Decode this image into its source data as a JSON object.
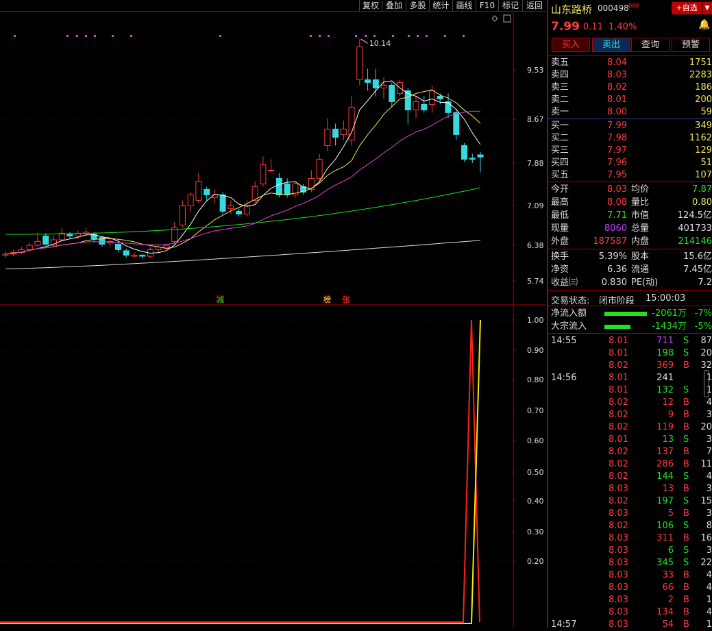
{
  "toolbar": {
    "items": [
      "复权",
      "叠加",
      "多股",
      "统计",
      "画线",
      "F10",
      "标记",
      "返回"
    ]
  },
  "stock": {
    "name": "山东路桥",
    "code": "000498",
    "superscript": "000",
    "price": "7.99",
    "change": "0.11",
    "pct": "1.40%",
    "self_select": "+自选"
  },
  "actions": [
    "买入",
    "卖出",
    "查询",
    "预警"
  ],
  "sells": [
    {
      "label": "卖五",
      "price": "8.04",
      "vol": "1751"
    },
    {
      "label": "卖四",
      "price": "8.03",
      "vol": "2283"
    },
    {
      "label": "卖三",
      "price": "8.02",
      "vol": "186"
    },
    {
      "label": "卖二",
      "price": "8.01",
      "vol": "200"
    },
    {
      "label": "卖一",
      "price": "8.00",
      "vol": "59"
    }
  ],
  "buys": [
    {
      "label": "买一",
      "price": "7.99",
      "vol": "349"
    },
    {
      "label": "买二",
      "price": "7.98",
      "vol": "1162"
    },
    {
      "label": "买三",
      "price": "7.97",
      "vol": "129"
    },
    {
      "label": "买四",
      "price": "7.96",
      "vol": "51"
    },
    {
      "label": "买五",
      "price": "7.95",
      "vol": "107"
    }
  ],
  "stats1": [
    {
      "l": "今开",
      "v": "8.03",
      "l2": "均价",
      "v2": "7.87"
    },
    {
      "l": "最高",
      "v": "8.08",
      "l2": "量比",
      "v2": "0.80"
    },
    {
      "l": "最低",
      "v": "7.71",
      "l2": "市值",
      "v2": "124.5亿"
    },
    {
      "l": "现量",
      "v": "8060",
      "l2": "总量",
      "v2": "401733"
    },
    {
      "l": "外盘",
      "v": "187587",
      "l2": "内盘",
      "v2": "214146"
    }
  ],
  "stats2": [
    {
      "l": "换手",
      "v": "5.39%",
      "l2": "股本",
      "v2": "15.6亿"
    },
    {
      "l": "净资",
      "v": "6.36",
      "l2": "流通",
      "v2": "7.45亿"
    },
    {
      "l": "收益㈢",
      "v": "0.830",
      "l2": "PE(动)",
      "v2": "7.2"
    }
  ],
  "status": {
    "label": "交易状态:",
    "value": "闭市阶段",
    "time": "15:00:03"
  },
  "flows": [
    {
      "label": "净流入额",
      "amount": "-2061万",
      "pct": "-7%"
    },
    {
      "label": "大宗流入",
      "amount": "-1434万",
      "pct": "-5%"
    }
  ],
  "ticks": [
    {
      "t": "14:55",
      "p": "8.01",
      "v": "711",
      "d": "S",
      "n": "87"
    },
    {
      "t": "",
      "p": "8.01",
      "v": "198",
      "d": "S",
      "n": "20"
    },
    {
      "t": "",
      "p": "8.02",
      "v": "369",
      "d": "B",
      "n": "32"
    },
    {
      "t": "14:56",
      "p": "8.01",
      "v": "241",
      "d": "",
      "n": "1"
    },
    {
      "t": "",
      "p": "8.01",
      "v": "132",
      "d": "S",
      "n": "1"
    },
    {
      "t": "",
      "p": "8.02",
      "v": "12",
      "d": "B",
      "n": "4"
    },
    {
      "t": "",
      "p": "8.02",
      "v": "9",
      "d": "B",
      "n": "3"
    },
    {
      "t": "",
      "p": "8.02",
      "v": "119",
      "d": "B",
      "n": "20"
    },
    {
      "t": "",
      "p": "8.01",
      "v": "13",
      "d": "S",
      "n": "3"
    },
    {
      "t": "",
      "p": "8.02",
      "v": "137",
      "d": "B",
      "n": "7"
    },
    {
      "t": "",
      "p": "8.02",
      "v": "286",
      "d": "B",
      "n": "11"
    },
    {
      "t": "",
      "p": "8.02",
      "v": "144",
      "d": "S",
      "n": "4"
    },
    {
      "t": "",
      "p": "8.03",
      "v": "13",
      "d": "B",
      "n": "3"
    },
    {
      "t": "",
      "p": "8.02",
      "v": "197",
      "d": "S",
      "n": "15"
    },
    {
      "t": "",
      "p": "8.03",
      "v": "5",
      "d": "B",
      "n": "3"
    },
    {
      "t": "",
      "p": "8.02",
      "v": "106",
      "d": "S",
      "n": "8"
    },
    {
      "t": "",
      "p": "8.03",
      "v": "311",
      "d": "B",
      "n": "16"
    },
    {
      "t": "",
      "p": "8.03",
      "v": "6",
      "d": "S",
      "n": "3"
    },
    {
      "t": "",
      "p": "8.03",
      "v": "345",
      "d": "S",
      "n": "22"
    },
    {
      "t": "",
      "p": "8.03",
      "v": "33",
      "d": "B",
      "n": "4"
    },
    {
      "t": "",
      "p": "8.03",
      "v": "66",
      "d": "B",
      "n": "4"
    },
    {
      "t": "",
      "p": "8.03",
      "v": "2",
      "d": "B",
      "n": "1"
    },
    {
      "t": "",
      "p": "8.03",
      "v": "134",
      "d": "B",
      "n": "4"
    },
    {
      "t": "14:57",
      "p": "8.03",
      "v": "54",
      "d": "B",
      "n": "1"
    }
  ],
  "chart_data": {
    "type": "candlestick",
    "price_axis": [
      "9.53",
      "8.67",
      "7.88",
      "7.09",
      "6.38",
      "5.74"
    ],
    "high_label": "10.14",
    "markers": [
      "减",
      "榜",
      "张"
    ],
    "indicator_axis": [
      "1.00",
      "0.90",
      "0.80",
      "0.70",
      "0.60",
      "0.50",
      "0.40",
      "0.30",
      "0.20"
    ],
    "colors": {
      "up": "#ff3b3b",
      "down": "#37d9e0",
      "ma5": "#ffffff",
      "ma10": "#f2e45a",
      "ma20": "#e040e0",
      "ma60": "#23e023",
      "ma120": "#dddddd"
    },
    "candles": [
      [
        6.2,
        6.22,
        6.28,
        6.15
      ],
      [
        6.22,
        6.25,
        6.3,
        6.18
      ],
      [
        6.25,
        6.3,
        6.35,
        6.22
      ],
      [
        6.3,
        6.38,
        6.42,
        6.28
      ],
      [
        6.38,
        6.45,
        6.6,
        6.35
      ],
      [
        6.55,
        6.4,
        6.6,
        6.38
      ],
      [
        6.38,
        6.48,
        6.55,
        6.35
      ],
      [
        6.48,
        6.6,
        6.7,
        6.45
      ],
      [
        6.58,
        6.55,
        6.62,
        6.5
      ],
      [
        6.55,
        6.6,
        6.65,
        6.5
      ],
      [
        6.6,
        6.62,
        6.7,
        6.55
      ],
      [
        6.58,
        6.5,
        6.62,
        6.45
      ],
      [
        6.52,
        6.4,
        6.55,
        6.35
      ],
      [
        6.42,
        6.45,
        6.5,
        6.35
      ],
      [
        6.4,
        6.3,
        6.42,
        6.25
      ],
      [
        6.28,
        6.2,
        6.32,
        6.15
      ],
      [
        6.18,
        6.2,
        6.25,
        6.15
      ],
      [
        6.2,
        6.18,
        6.22,
        6.14
      ],
      [
        6.18,
        6.3,
        6.35,
        6.15
      ],
      [
        6.3,
        6.35,
        6.38,
        6.25
      ],
      [
        6.32,
        6.38,
        6.4,
        6.3
      ],
      [
        6.45,
        6.7,
        6.8,
        6.4
      ],
      [
        6.75,
        7.1,
        7.2,
        6.7
      ],
      [
        7.1,
        7.3,
        7.35,
        7.0
      ],
      [
        7.2,
        7.55,
        7.7,
        7.15
      ],
      [
        7.4,
        7.3,
        7.45,
        7.2
      ],
      [
        7.25,
        7.3,
        7.4,
        7.15
      ],
      [
        7.3,
        7.0,
        7.35,
        6.95
      ],
      [
        7.05,
        7.1,
        7.2,
        6.95
      ],
      [
        7.0,
        6.95,
        7.05,
        6.9
      ],
      [
        6.95,
        7.1,
        7.2,
        6.9
      ],
      [
        7.2,
        7.45,
        7.55,
        7.15
      ],
      [
        7.5,
        7.85,
        8.0,
        7.45
      ],
      [
        7.75,
        7.75,
        7.95,
        7.7
      ],
      [
        7.6,
        7.3,
        7.7,
        7.25
      ],
      [
        7.5,
        7.3,
        7.6,
        7.25
      ],
      [
        7.3,
        7.5,
        7.55,
        7.25
      ],
      [
        7.45,
        7.35,
        7.5,
        7.3
      ],
      [
        7.4,
        7.6,
        7.75,
        7.35
      ],
      [
        7.6,
        7.95,
        8.05,
        7.55
      ],
      [
        8.2,
        8.5,
        8.7,
        8.1
      ],
      [
        8.5,
        8.35,
        8.6,
        8.2
      ],
      [
        8.4,
        8.5,
        8.65,
        8.3
      ],
      [
        8.3,
        8.9,
        9.1,
        8.2
      ],
      [
        9.4,
        10.0,
        10.14,
        9.3
      ],
      [
        9.4,
        9.35,
        9.6,
        9.2
      ],
      [
        9.4,
        9.25,
        9.6,
        9.1
      ],
      [
        9.25,
        9.3,
        9.45,
        9.05
      ],
      [
        9.3,
        9.0,
        9.35,
        8.9
      ],
      [
        9.15,
        9.35,
        9.4,
        9.1
      ],
      [
        9.2,
        8.85,
        9.25,
        8.6
      ],
      [
        8.85,
        9.0,
        9.1,
        8.7
      ],
      [
        8.95,
        8.85,
        9.1,
        8.8
      ],
      [
        8.95,
        9.2,
        9.3,
        8.8
      ],
      [
        9.1,
        9.05,
        9.15,
        8.95
      ],
      [
        9.0,
        8.8,
        9.15,
        8.7
      ],
      [
        8.8,
        8.4,
        8.85,
        8.3
      ],
      [
        8.2,
        7.95,
        8.25,
        7.9
      ],
      [
        7.97,
        7.95,
        8.05,
        7.88
      ],
      [
        8.03,
        7.99,
        8.08,
        7.71
      ]
    ]
  }
}
